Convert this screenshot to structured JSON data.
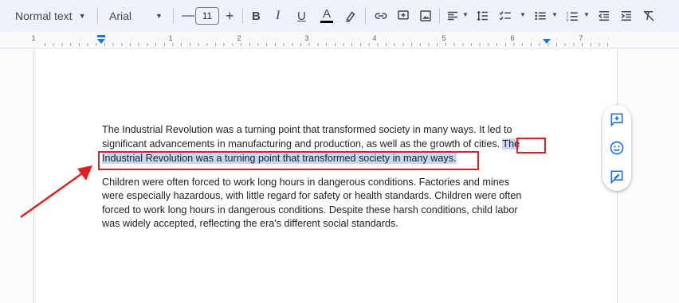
{
  "toolbar": {
    "style_value": "Normal text",
    "font_value": "Arial",
    "decrease_label": "—",
    "font_size": "11",
    "increase_label": "+",
    "bold_label": "B",
    "italic_label": "I",
    "underline_label": "U",
    "text_color_label": "A"
  },
  "ruler": {
    "numbers": [
      "1",
      "1",
      "2",
      "3",
      "4",
      "5",
      "6",
      "7"
    ]
  },
  "document": {
    "para1_line1": "The Industrial Revolution was a turning point that transformed society in many ways. It led to",
    "para1_line2_start": "significant advancements in manufacturing and production, as well as the growth of cities. ",
    "para1_line2_selected": "The",
    "para1_line3_selected": "Industrial Revolution was a turning point that transformed society in many ways.",
    "para2_line1": "Children were often forced to work long hours in dangerous conditions. Factories and mines",
    "para2_line2": "were especially hazardous, with little regard for safety or health standards. Children were often",
    "para2_line3": "forced to work long hours in dangerous conditions. Despite these harsh conditions, child labor",
    "para2_line4": "was widely accepted, reflecting the era's different social standards."
  },
  "colors": {
    "highlight": "#c5d7f1",
    "annotation_red": "#e02020",
    "accent_blue": "#1a73e8"
  },
  "side_panel": {
    "icons": [
      "add-comment-icon",
      "emoji-reaction-icon",
      "suggest-edit-icon"
    ]
  }
}
